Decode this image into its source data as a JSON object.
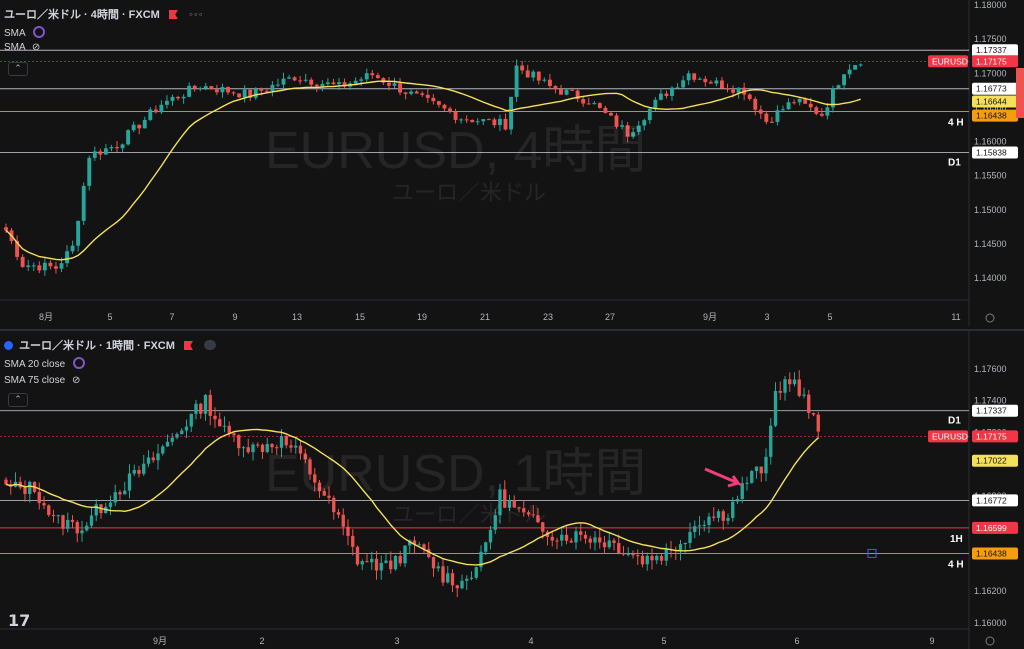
{
  "top_pane": {
    "title": "ユーロ／米ドル · 4時間 · FXCM",
    "indicator_label": "SMA",
    "indicator2_label": "SMA",
    "watermark_symbol": "EURUSD, 4時間",
    "watermark_name": "ユーロ／米ドル",
    "price_ticks": [
      "1.18000",
      "1.17500",
      "1.17000",
      "1.16500",
      "1.16000",
      "1.15500",
      "1.15000",
      "1.14500",
      "1.14000"
    ],
    "time_ticks": [
      "8月",
      "5",
      "7",
      "9",
      "13",
      "15",
      "19",
      "21",
      "23",
      "27",
      "9月",
      "3",
      "5",
      "11"
    ],
    "price_labels": [
      {
        "text": "1.17337",
        "kind": "white"
      },
      {
        "text": "EURUSD",
        "kind": "red"
      },
      {
        "text": "1.17175",
        "kind": "red"
      },
      {
        "text": "1.16773",
        "kind": "white"
      },
      {
        "text": "1.16644",
        "kind": "yellow"
      },
      {
        "text": "1.16438",
        "kind": "orange"
      },
      {
        "text": "1.15838",
        "kind": "white"
      }
    ],
    "level_tags": [
      "4 H",
      "D1"
    ]
  },
  "bottom_pane": {
    "title": "ユーロ／米ドル · 1時間 · FXCM",
    "indicator_label": "SMA 20 close",
    "indicator2_label": "SMA 75 close",
    "watermark_symbol": "EURUSD, 1時間",
    "watermark_name": "ユーロ／米ドル",
    "price_ticks": [
      "1.17600",
      "1.17400",
      "1.17200",
      "1.16800",
      "1.16400",
      "1.16200",
      "1.16000"
    ],
    "time_ticks": [
      "9月",
      "2",
      "3",
      "4",
      "5",
      "6",
      "9"
    ],
    "price_labels": [
      {
        "text": "1.17337",
        "kind": "white"
      },
      {
        "text": "EURUSD",
        "kind": "red"
      },
      {
        "text": "1.17175",
        "kind": "red"
      },
      {
        "text": "1.17022",
        "kind": "yellow"
      },
      {
        "text": "1.16772",
        "kind": "white"
      },
      {
        "text": "1.16599",
        "kind": "red"
      },
      {
        "text": "1.16438",
        "kind": "orange"
      }
    ],
    "level_tags": [
      "D1",
      "1H",
      "4 H"
    ]
  },
  "colors": {
    "up": "#26a69a",
    "down": "#ef5350",
    "sma": "#f5e05a",
    "orange": "#f59d0e",
    "bg": "#131313"
  },
  "icons": {
    "logo": "tradingview-logo-icon",
    "flag": "flag-icon",
    "more": "more-icon",
    "eye": "eye-off-icon",
    "settings": "gear-icon"
  }
}
